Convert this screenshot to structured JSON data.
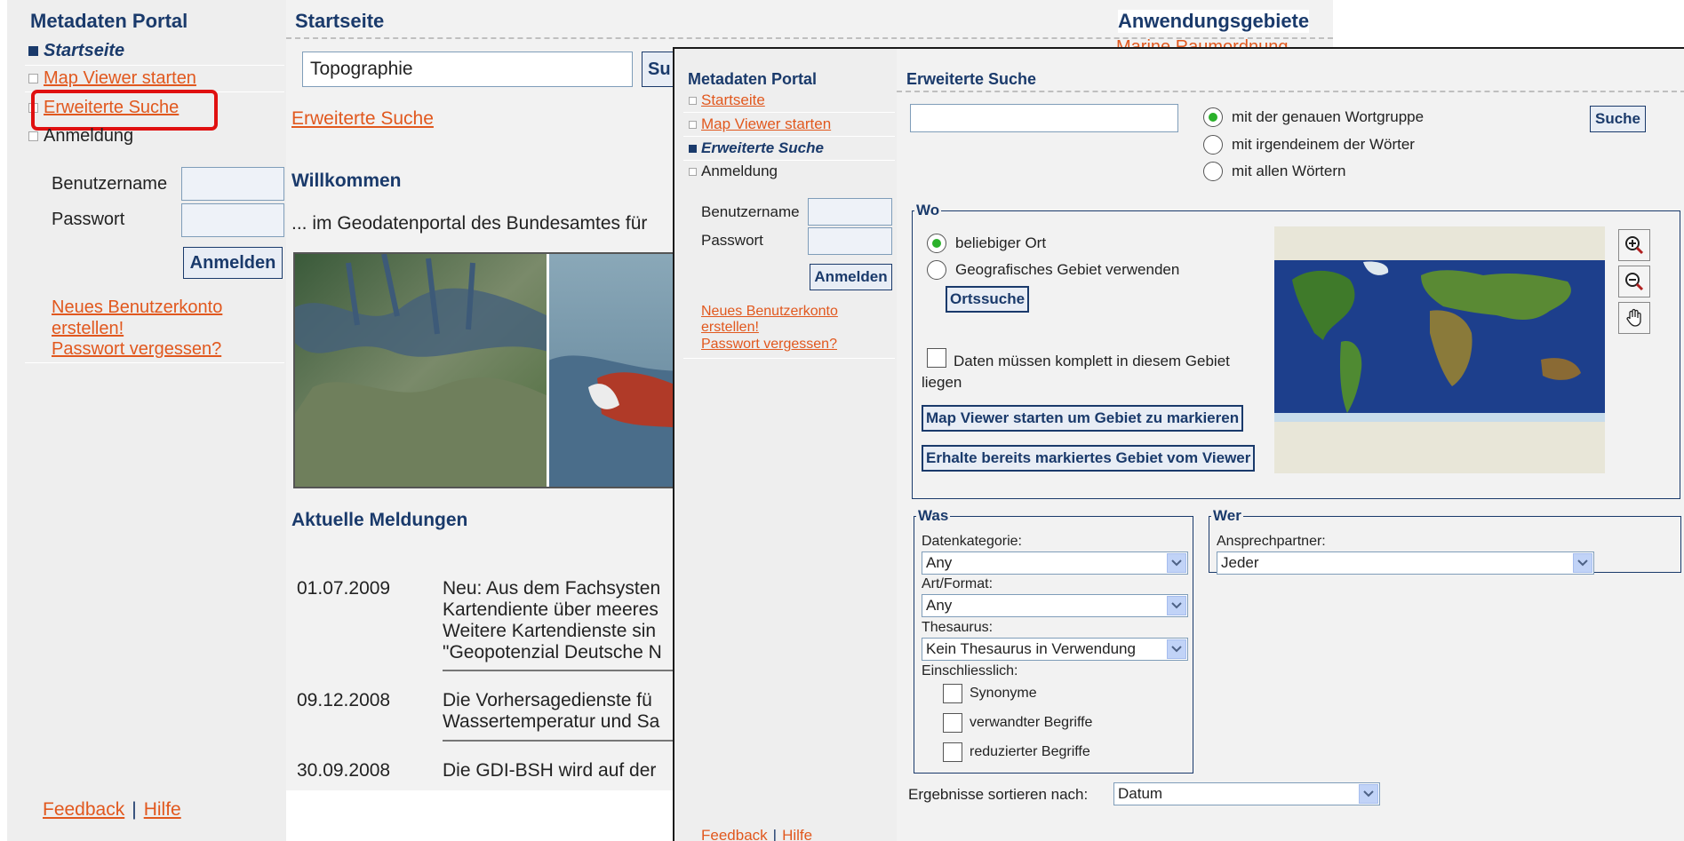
{
  "back": {
    "portal_title": "Metadaten Portal",
    "nav": [
      {
        "label": "Startseite"
      },
      {
        "label": "Map Viewer starten"
      },
      {
        "label": "Erweiterte Suche"
      },
      {
        "label": "Anmeldung"
      }
    ],
    "login": {
      "username_label": "Benutzername",
      "password_label": "Passwort",
      "button": "Anmelden",
      "new_account": "Neues Benutzerkonto erstellen!",
      "forgot": "Passwort vergessen?"
    },
    "footer": {
      "feedback": "Feedback",
      "sep": "|",
      "help": "Hilfe"
    },
    "main": {
      "heading": "Startseite",
      "search_value": "Topographie",
      "search_button": "Su",
      "advanced_link": "Erweiterte Suche",
      "welcome": "Willkommen",
      "intro": "... im Geodatenportal des Bundesamtes für",
      "news_title": "Aktuelle Meldungen",
      "news": [
        {
          "date": "01.07.2009",
          "lines": [
            "Neu: Aus dem Fachsysten",
            "Kartendiente über meeres",
            "Weitere Kartendienste sin",
            "\"Geopotenzial Deutsche N"
          ]
        },
        {
          "date": "09.12.2008",
          "lines": [
            "Die Vorhersagedienste fü",
            "Wassertemperatur und Sa"
          ]
        },
        {
          "date": "30.09.2008",
          "lines": [
            "Die GDI-BSH wird auf der"
          ]
        }
      ]
    },
    "right": {
      "title": "Anwendungsgebiete",
      "item": "Marine Raumordnung"
    }
  },
  "front": {
    "portal_title": "Metadaten Portal",
    "nav": [
      {
        "label": "Startseite"
      },
      {
        "label": "Map Viewer starten"
      },
      {
        "label": "Erweiterte Suche"
      },
      {
        "label": "Anmeldung"
      }
    ],
    "login": {
      "username_label": "Benutzername",
      "password_label": "Passwort",
      "button": "Anmelden",
      "new_account_1": "Neues Benutzerkonto",
      "new_account_2": "erstellen!",
      "forgot": "Passwort vergessen?"
    },
    "footer": {
      "feedback": "Feedback",
      "sep": "|",
      "help": "Hilfe"
    },
    "main": {
      "heading": "Erweiterte Suche",
      "search_value": "",
      "search_button": "Suche",
      "match_options": [
        {
          "label": "mit der genauen Wortgruppe",
          "selected": true
        },
        {
          "label": "mit irgendeinem der Wörter",
          "selected": false
        },
        {
          "label": "mit allen Wörtern",
          "selected": false
        }
      ],
      "wo": {
        "legend": "Wo",
        "opt_any": "beliebiger Ort",
        "opt_geo": "Geografisches Gebiet verwenden",
        "ort_button": "Ortssuche",
        "complete_1": "Daten müssen komplett in diesem Gebiet",
        "complete_2": "liegen",
        "map_button_1": "Map Viewer starten um Gebiet zu markieren",
        "map_button_2": "Erhalte bereits markiertes Gebiet vom Viewer"
      },
      "was": {
        "legend": "Was",
        "datenkategorie_label": "Datenkategorie:",
        "datenkategorie_value": "Any",
        "format_label": "Art/Format:",
        "format_value": "Any",
        "thesaurus_label": "Thesaurus:",
        "thesaurus_value": "Kein Thesaurus in Verwendung",
        "include_label": "Einschliesslich:",
        "include_options": [
          "Synonyme",
          "verwandter Begriffe",
          "reduzierter Begriffe"
        ]
      },
      "wer": {
        "legend": "Wer",
        "contact_label": "Ansprechpartner:",
        "contact_value": "Jeder"
      },
      "sort_label": "Ergebnisse sortieren nach:",
      "sort_value": "Datum"
    }
  }
}
